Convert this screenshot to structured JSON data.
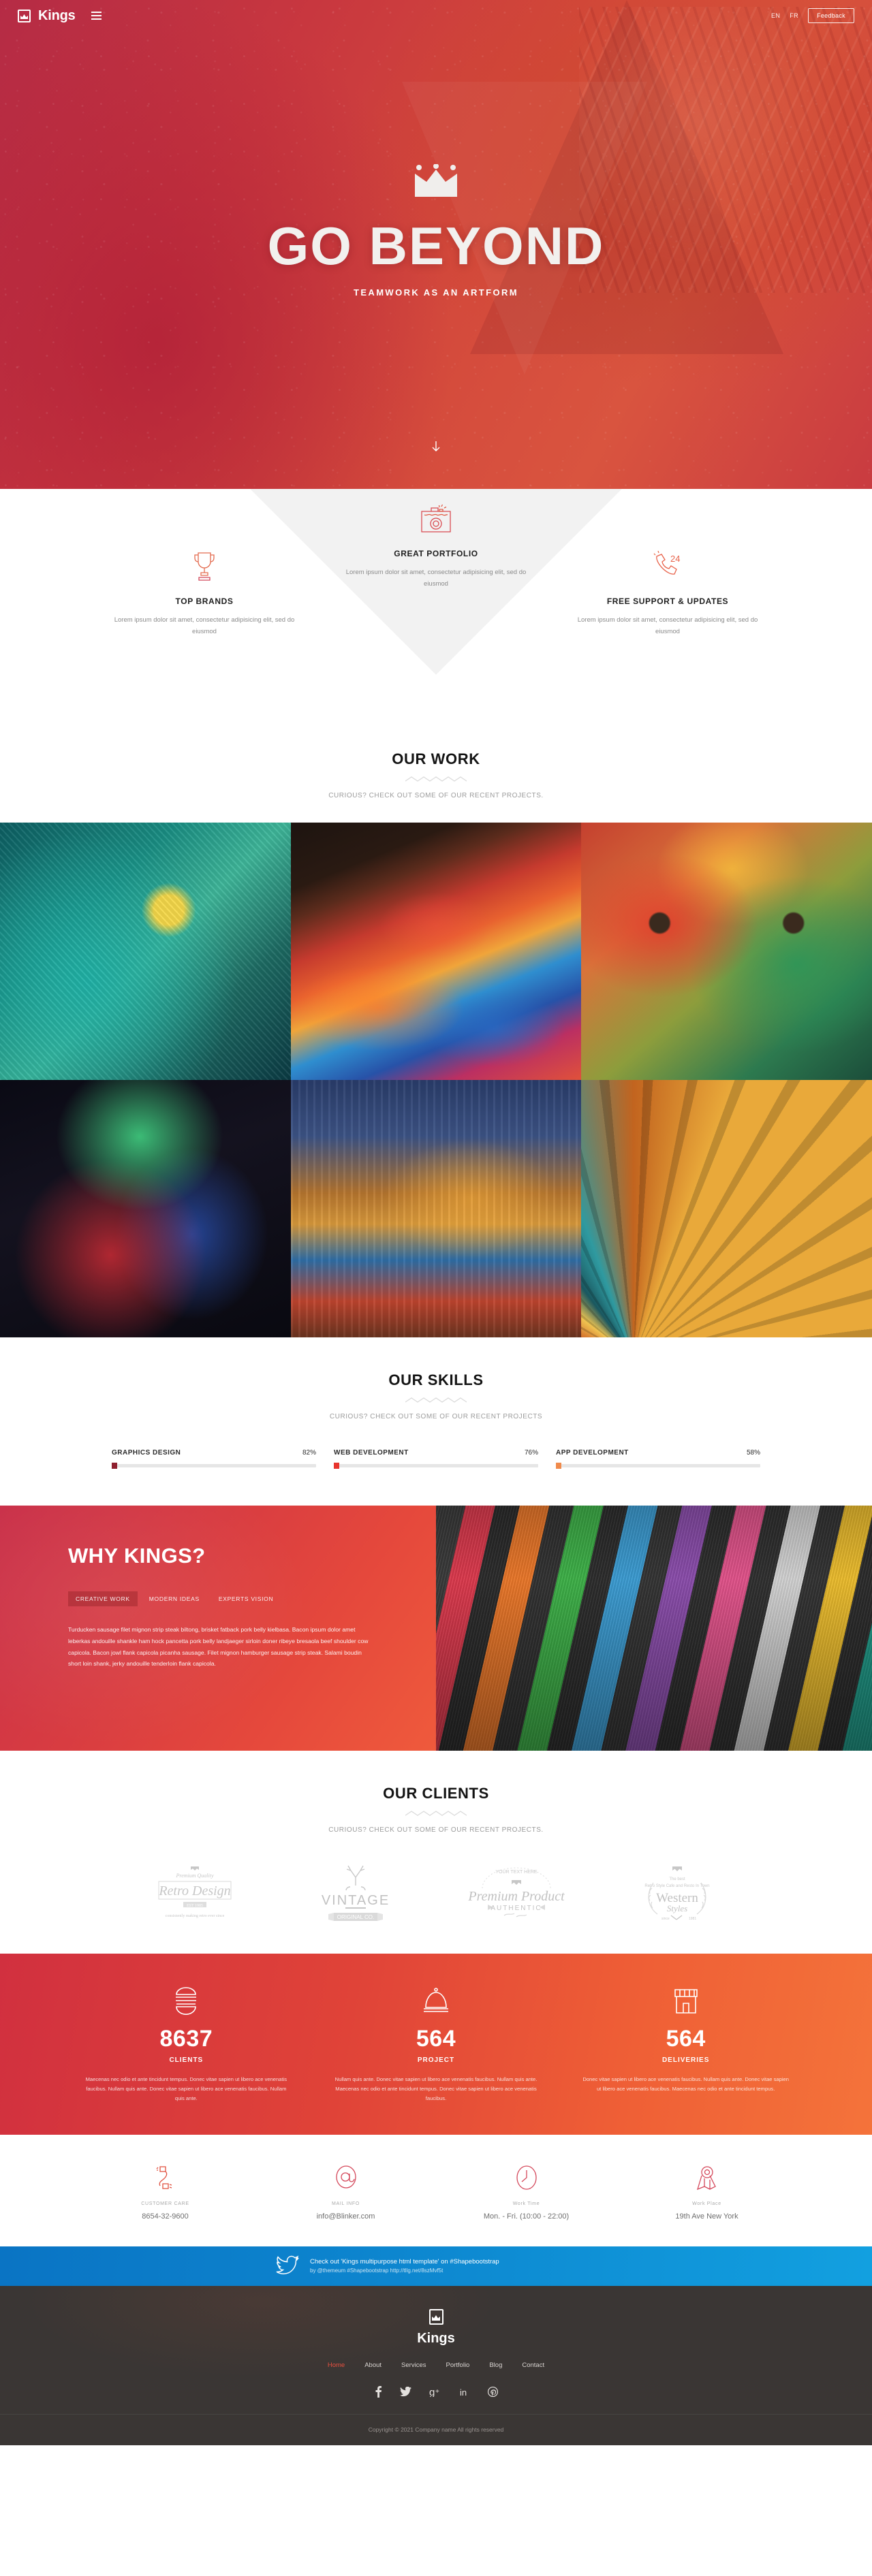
{
  "header": {
    "brand": "Kings",
    "logo_icon": "crown-in-box-icon",
    "menu_icon": "hamburger-menu-icon",
    "lang_en": "EN",
    "lang_fr": "FR",
    "feedback_label": "Feedback"
  },
  "hero": {
    "crown_icon": "crown-icon",
    "title": "GO BEYOND",
    "subtitle": "TEAMWORK AS AN ARTFORM",
    "scroll_icon": "scroll-down-arrow-icon"
  },
  "features": [
    {
      "icon": "trophy-icon",
      "title": "TOP BRANDS",
      "text": "Lorem ipsum dolor sit amet, consectetur adipisicing elit, sed do eiusmod"
    },
    {
      "icon": "camera-icon",
      "title": "GREAT PORTFOLIO",
      "text": "Lorem ipsum dolor sit amet, consectetur adipisicing elit, sed do eiusmod"
    },
    {
      "icon": "phone-24-support-icon",
      "title": "FREE SUPPORT & UPDATES",
      "text": "Lorem ipsum dolor sit amet, consectetur adipisicing elit, sed do eiusmod"
    }
  ],
  "work": {
    "title": "OUR WORK",
    "subtitle": "CURIOUS? CHECK OUT SOME OF OUR RECENT PROJECTS.",
    "items": [
      "portfolio-lizard",
      "portfolio-paint",
      "portfolio-face-paint",
      "portfolio-body-paint",
      "portfolio-city-collage",
      "portfolio-color-fan"
    ]
  },
  "skills": {
    "title": "OUR SKILLS",
    "subtitle": "CURIOUS? CHECK OUT SOME OF OUR RECENT PROJECTS",
    "items": [
      {
        "name": "GRAPHICS DESIGN",
        "percent": "82%",
        "value": 82,
        "color": "#8e1f2e"
      },
      {
        "name": "WEB DEVELOPMENT",
        "percent": "76%",
        "value": 76,
        "color": "#e8352e"
      },
      {
        "name": "APP DEVELOPMENT",
        "percent": "58%",
        "value": 58,
        "color": "#f08a4b"
      }
    ]
  },
  "why": {
    "title": "WHY KINGS?",
    "tabs": [
      {
        "label": "CREATIVE WORK",
        "active": true
      },
      {
        "label": "MODERN IDEAS",
        "active": false
      },
      {
        "label": "EXPERTS VISION",
        "active": false
      }
    ],
    "body": "Turducken sausage filet mignon strip steak biltong, brisket fatback pork belly kielbasa. Bacon ipsum dolor amet leberkas andouille shankle ham hock pancetta pork belly landjaeger sirloin doner ribeye bresaola beef shoulder cow capicola. Bacon jowl flank capicola picanha sausage. Filet mignon hamburger sausage strip steak. Salami boudin short loin shank, jerky andouille tenderloin flank capicola.",
    "image": "colored-pencils-photo"
  },
  "clients": {
    "title": "OUR CLIENTS",
    "subtitle": "CURIOUS? CHECK OUT SOME OF OUR RECENT PROJECTS.",
    "logos": [
      {
        "name": "retro-design-logo",
        "top": "Premium Quality",
        "main": "Retro Design",
        "badge": "EST 1985",
        "bottom": "consistently making retro ever since"
      },
      {
        "name": "vintage-logo",
        "main": "VINTAGE",
        "ribbon": "ORIGINAL CO."
      },
      {
        "name": "premium-product-logo",
        "top": "YOUR TEXT HERE",
        "main": "Premium Product",
        "sub": "AUTHENTIC"
      },
      {
        "name": "western-styles-logo",
        "top": "The best",
        "sub2": "Retro Style Cafe and Resto In Town",
        "main": "Western",
        "main2": "Styles",
        "bottom": "since 1981"
      }
    ]
  },
  "stats": [
    {
      "icon": "burger-icon",
      "number": "8637",
      "label": "CLIENTS",
      "text": "Maecenas nec odio et ante tincidunt tempus. Donec vitae sapien ut libero ace venenatis faucibus. Nullam quis ante. Donec vitae sapien ut libero ace venenatis faucibus. Nullam quis ante."
    },
    {
      "icon": "cloche-icon",
      "number": "564",
      "label": "PROJECT",
      "text": "Nullam quis ante. Donec vitae sapien ut libero ace venenatis faucibus. Nullam quis ante. Maecenas nec odio et ante tincidunt tempus. Donec vitae sapien ut libero ace venenatis faucibus."
    },
    {
      "icon": "shop-icon",
      "number": "564",
      "label": "DELIVERIES",
      "text": "Donec vitae sapien ut libero ace venenatis faucibus. Nullam quis ante. Donec vitae sapien ut libero ace venenatis faucibus. Maecenas nec odio et ante tincidunt tempus."
    }
  ],
  "contact": [
    {
      "icon": "phone-cord-icon",
      "label": "CUSTOMER CARE",
      "value": "8654-32-9600"
    },
    {
      "icon": "at-sign-icon",
      "label": "MAIL INFO",
      "value": "info@Blinker.com"
    },
    {
      "icon": "clock-icon",
      "label": "Work Time",
      "value": "Mon. - Fri. (10:00 - 22:00)"
    },
    {
      "icon": "map-pin-icon",
      "label": "Work Place",
      "value": "19th Ave New York"
    }
  ],
  "twitter": {
    "icon": "twitter-bird-icon",
    "line1": "Check out 'Kings multipurpose html template' on #Shapebootstrap",
    "line2": "by @themeum #Shapebootstrap http://tllg.net/8szMvf5t"
  },
  "footer": {
    "logo_icon": "crown-in-box-icon",
    "brand": "Kings",
    "nav": [
      {
        "label": "Home",
        "active": true
      },
      {
        "label": "About",
        "active": false
      },
      {
        "label": "Services",
        "active": false
      },
      {
        "label": "Portfolio",
        "active": false
      },
      {
        "label": "Blog",
        "active": false
      },
      {
        "label": "Contact",
        "active": false
      }
    ],
    "social": [
      {
        "name": "facebook-icon",
        "glyph": "f"
      },
      {
        "name": "twitter-icon",
        "glyph": "ᴠ"
      },
      {
        "name": "google-plus-icon",
        "glyph": "g+"
      },
      {
        "name": "linkedin-icon",
        "glyph": "in"
      },
      {
        "name": "pinterest-icon",
        "glyph": "Ⓟ"
      }
    ],
    "copyright": "Copyright © 2021 Company name All rights reserved"
  },
  "colors": {
    "brand_red": "#e0433a",
    "twitter_blue": "#0d86cf",
    "footer_dark": "#3a3634"
  }
}
